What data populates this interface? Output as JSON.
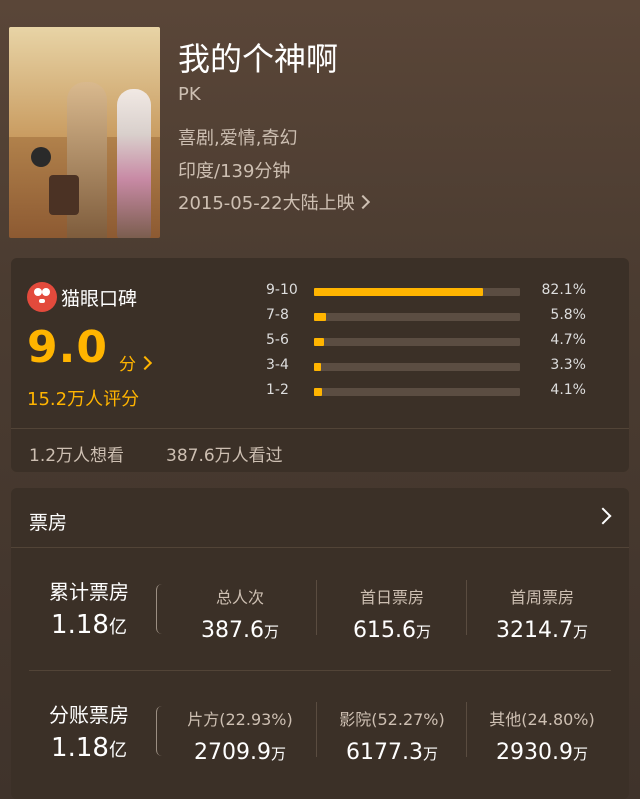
{
  "movie": {
    "title": "我的个神啊",
    "en_title": "PK",
    "genre": "喜剧,爱情,奇幻",
    "country_duration": "印度/139分钟",
    "release": "2015-05-22大陆上映"
  },
  "rating": {
    "brand": "猫眼口碑",
    "score": "9.0",
    "score_unit": "分",
    "count": "15.2万人评分",
    "distribution": [
      {
        "range": "9-10",
        "pct_text": "82.1%",
        "pct": 82.1
      },
      {
        "range": "7-8",
        "pct_text": "5.8%",
        "pct": 5.8
      },
      {
        "range": "5-6",
        "pct_text": "4.7%",
        "pct": 4.7
      },
      {
        "range": "3-4",
        "pct_text": "3.3%",
        "pct": 3.3
      },
      {
        "range": "1-2",
        "pct_text": "4.1%",
        "pct": 4.1
      }
    ],
    "want_to_see": "1.2万人想看",
    "watched": "387.6万人看过"
  },
  "box_office": {
    "title": "票房",
    "total": {
      "label": "累计票房",
      "value": "1.18",
      "unit": "亿",
      "cells": [
        {
          "label": "总人次",
          "value": "387.6",
          "unit": "万"
        },
        {
          "label": "首日票房",
          "value": "615.6",
          "unit": "万"
        },
        {
          "label": "首周票房",
          "value": "3214.7",
          "unit": "万"
        }
      ]
    },
    "split": {
      "label": "分账票房",
      "value": "1.18",
      "unit": "亿",
      "cells": [
        {
          "label": "片方(22.93%)",
          "value": "2709.9",
          "unit": "万"
        },
        {
          "label": "影院(52.27%)",
          "value": "6177.3",
          "unit": "万"
        },
        {
          "label": "其他(24.80%)",
          "value": "2930.9",
          "unit": "万"
        }
      ]
    }
  },
  "colors": {
    "accent": "#ffb400",
    "card": "#3b3027"
  }
}
